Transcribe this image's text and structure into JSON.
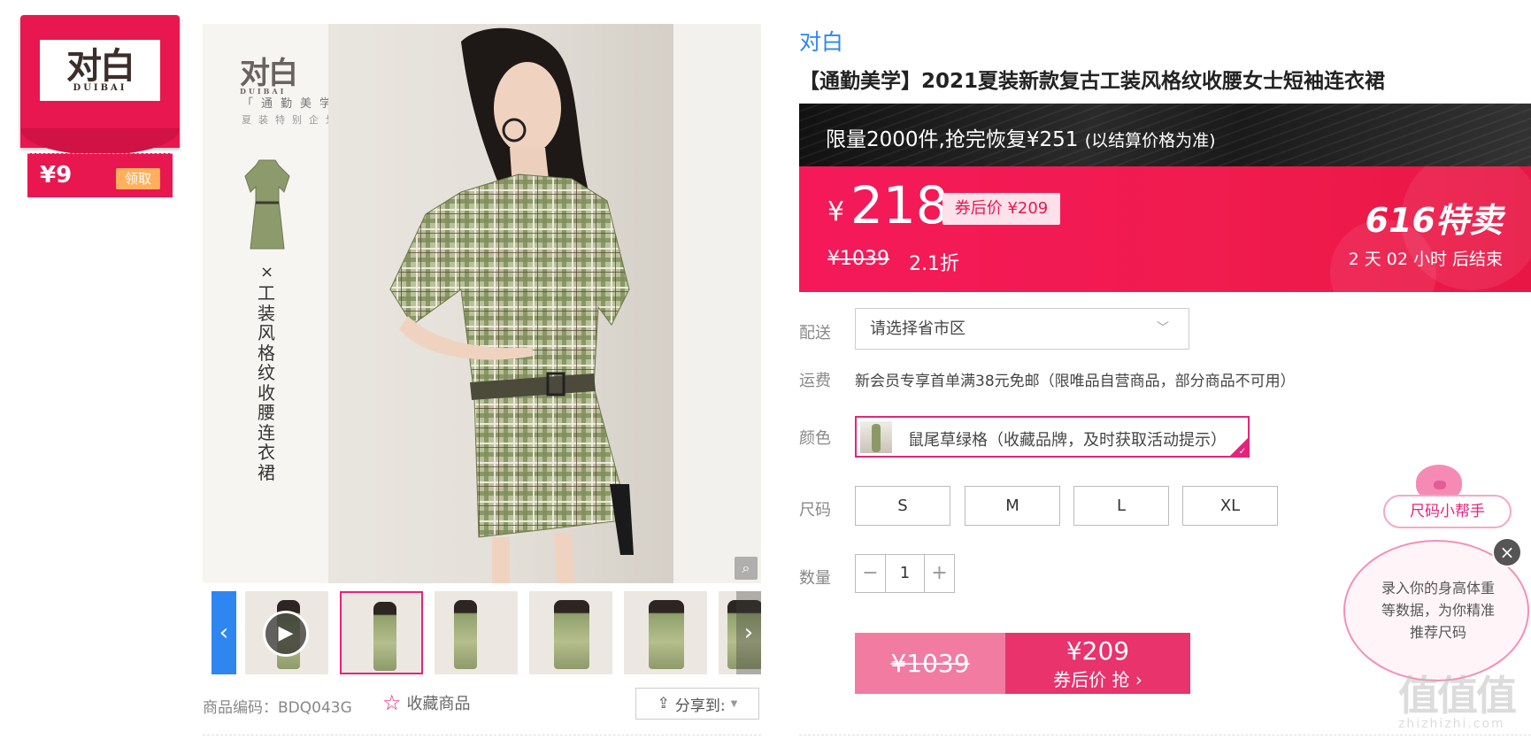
{
  "coupon": {
    "brand_cn": "对白",
    "brand_en": "DUIBAI",
    "amount": "¥9",
    "get_label": "领取"
  },
  "gallery": {
    "brandmark_cn": "对白",
    "brandmark_en": "DUIBAI",
    "slogan": "「通勤美学」",
    "slogan_sub": "夏装特别企划",
    "times": "×",
    "vertical_title": "工装风格纹收腰连衣裙",
    "zoom_icon": "magnifier-icon",
    "prev_icon": "chevron-left-icon",
    "next_icon": "chevron-right-icon"
  },
  "product_code": {
    "text": "商品编码：BDQ043G"
  },
  "favorite": {
    "label": "收藏商品",
    "icon": "star-outline-icon"
  },
  "share": {
    "label": "分享到:",
    "icon": "share-icon"
  },
  "product": {
    "brand": "对白",
    "title": "【通勤美学】2021夏装新款复古工装风格纹收腰女士短袖连衣裙"
  },
  "limit_banner": {
    "text": "限量2000件,抢完恢复¥251",
    "note": "(以结算价格为准)"
  },
  "price": {
    "currency": "¥",
    "current": "218",
    "after_coupon": "券后价 ¥209",
    "original": "¥1039",
    "discount": "2.1折",
    "event": "616特卖",
    "countdown": "2 天 02 小时 后结束",
    "accent": "#f01b4d"
  },
  "delivery": {
    "label": "配送",
    "placeholder": "请选择省市区"
  },
  "freight": {
    "label": "运费",
    "text": "新会员专享首单满38元免邮（限唯品自营商品，部分商品不可用）"
  },
  "color": {
    "label": "颜色",
    "selected": "鼠尾草绿格（收藏品牌，及时获取活动提示）"
  },
  "size": {
    "label": "尺码",
    "options": [
      "S",
      "M",
      "L",
      "XL"
    ]
  },
  "quantity": {
    "label": "数量",
    "minus": "−",
    "value": "1",
    "plus": "+"
  },
  "buy": {
    "original": "¥1039",
    "price": "¥209",
    "action": "券后价 抢 ›"
  },
  "helper": {
    "tag": "尺码小帮手",
    "text": "录入你的身高体重等数据，为你精准推荐尺码",
    "close": "×"
  },
  "watermark": {
    "big": "值值值",
    "small": "zhizhizhi.com"
  }
}
